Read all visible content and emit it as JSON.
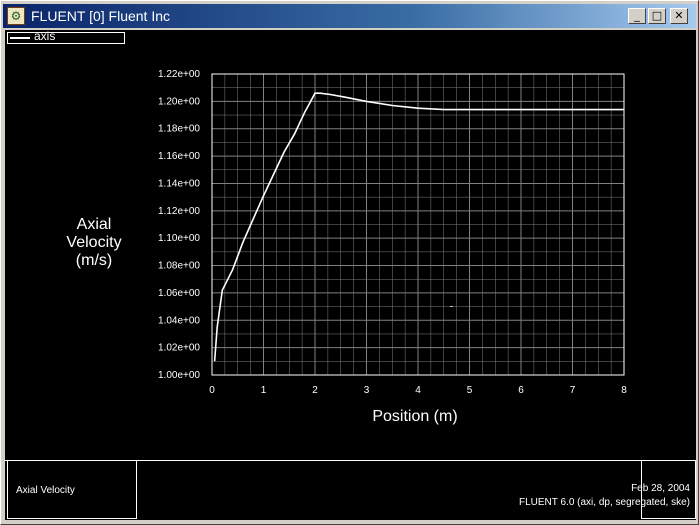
{
  "window": {
    "title": "FLUENT [0] Fluent Inc",
    "minimize": "_",
    "maximize": "□",
    "close": "✕"
  },
  "legend": {
    "label": "axis"
  },
  "plot": {
    "ylabel_lines": [
      "Axial",
      "Velocity",
      "(m/s)"
    ],
    "xlabel": "Position (m)"
  },
  "footer": {
    "plot_name": "Axial Velocity",
    "date": "Feb 28, 2004",
    "info": "FLUENT 6.0 (axi, dp, segregated, ske)"
  },
  "colors": {
    "background": "#000000",
    "foreground": "#ffffff",
    "grid": "#808080"
  },
  "chart_data": {
    "type": "line",
    "title": "",
    "xlabel": "Position (m)",
    "ylabel": "Axial Velocity (m/s)",
    "xlim": [
      0,
      8
    ],
    "ylim": [
      1.0,
      1.22
    ],
    "x_ticks": [
      "0",
      "1",
      "2",
      "3",
      "4",
      "5",
      "6",
      "7",
      "8"
    ],
    "y_ticks": [
      "1.00e+00",
      "1.02e+00",
      "1.04e+00",
      "1.06e+00",
      "1.08e+00",
      "1.10e+00",
      "1.12e+00",
      "1.14e+00",
      "1.16e+00",
      "1.18e+00",
      "1.20e+00",
      "1.22e+00"
    ],
    "grid": true,
    "series": [
      {
        "name": "axis",
        "x": [
          0.05,
          0.1,
          0.2,
          0.4,
          0.6,
          0.8,
          1.0,
          1.2,
          1.4,
          1.6,
          1.8,
          1.9,
          2.0,
          2.1,
          2.3,
          2.6,
          3.0,
          3.5,
          4.0,
          4.5,
          5.0,
          6.0,
          7.0,
          8.0
        ],
        "y": [
          1.01,
          1.035,
          1.062,
          1.077,
          1.097,
          1.114,
          1.131,
          1.147,
          1.163,
          1.176,
          1.192,
          1.199,
          1.206,
          1.206,
          1.205,
          1.203,
          1.2,
          1.197,
          1.195,
          1.194,
          1.194,
          1.194,
          1.194,
          1.194
        ]
      }
    ],
    "annotations": [
      {
        "x": 4.65,
        "y": 1.05,
        "text": "-"
      }
    ]
  }
}
